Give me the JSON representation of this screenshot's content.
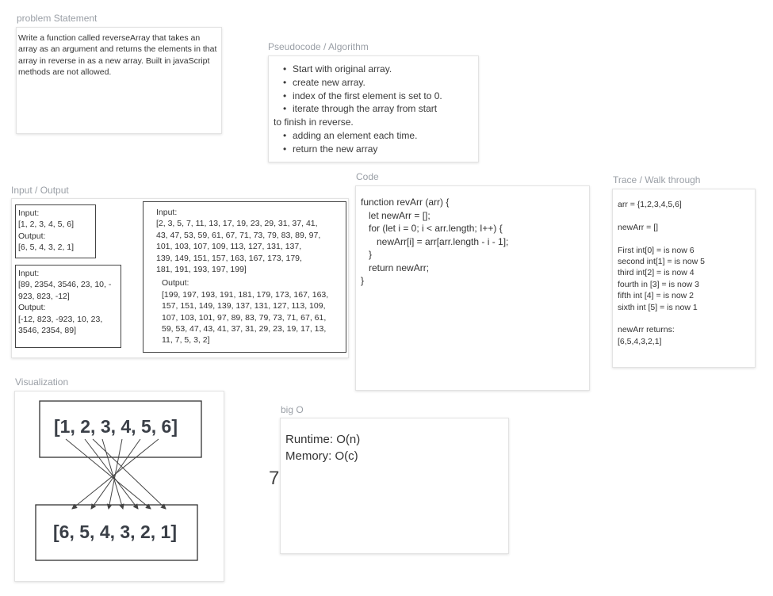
{
  "problem": {
    "label": "problem Statement",
    "text": "Write a function called reverseArray that takes an array as an argument and returns the elements in that array in reverse in as a new array. Built in javaScript methods are not allowed."
  },
  "pseudocode": {
    "label": "Pseudocode / Algorithm",
    "items": [
      "Start with original array.",
      "create new array.",
      "index of the first element is set to 0.",
      "iterate through the array from start",
      "to finish in reverse.",
      "adding an element each time.",
      "return the new array"
    ]
  },
  "io": {
    "label": "Input / Output",
    "box1": "Input:\n[1, 2, 3, 4, 5, 6]\nOutput:\n[6, 5, 4, 3, 2, 1]",
    "box2": "Input:\n[89, 2354, 3546, 23, 10, -\n923, 823, -12]\nOutput:\n[-12, 823, -923, 10, 23,\n3546, 2354, 89]",
    "box3_input": "Input:\n[2, 3, 5, 7, 11, 13, 17, 19, 23, 29, 31, 37, 41,\n43, 47, 53, 59, 61, 67, 71, 73, 79, 83, 89, 97,\n101, 103, 107, 109, 113, 127, 131, 137,\n139, 149, 151, 157, 163, 167, 173, 179,\n181, 191, 193, 197, 199]",
    "box3_output": "Output:\n[199, 197, 193, 191, 181, 179, 173, 167, 163,\n157, 151, 149, 139, 137, 131, 127, 113, 109,\n107, 103, 101, 97, 89, 83, 79, 73, 71, 67, 61,\n59, 53, 47, 43, 41, 37, 31, 29, 23, 19, 17, 13,\n11, 7, 5, 3, 2]"
  },
  "code": {
    "label": "Code",
    "lines": [
      "function revArr (arr) {",
      "   let newArr = [];",
      "   for (let i = 0; i < arr.length; I++) {",
      "      newArr[i] = arr[arr.length - i - 1];",
      "   }",
      "   return newArr;",
      "}"
    ]
  },
  "trace": {
    "label": "Trace / Walk through",
    "lines": [
      "arr = {1,2,3,4,5,6]",
      "",
      "newArr = []",
      "",
      "First int[0] = is now 6",
      "second int[1] = is now 5",
      "third int[2] = is now 4",
      "fourth in [3] = is now 3",
      "fifth int [4] = is now 2",
      "sixth int [5] = is now 1",
      "",
      "newArr returns:",
      "[6,5,4,3,2,1]"
    ]
  },
  "visualization": {
    "label": "Visualization",
    "top_array": "[1, 2, 3, 4, 5, 6]",
    "bottom_array": "[6, 5, 4, 3, 2, 1]"
  },
  "bigo": {
    "label": "big O",
    "runtime": "Runtime: O(n)",
    "memory": "Memory: O(c)"
  },
  "stray_text": "7"
}
